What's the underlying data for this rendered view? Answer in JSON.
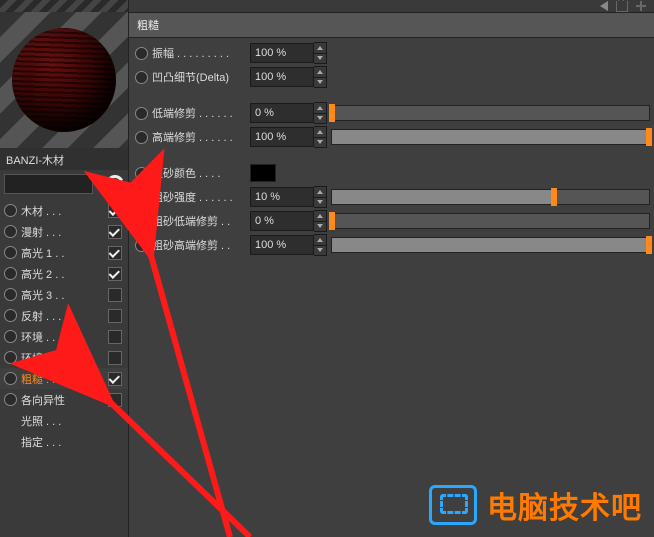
{
  "material_name": "BANZI-木材",
  "group_title": "粗糙",
  "channels": [
    {
      "label": "木材 . . .",
      "checked": true,
      "hasBox": true,
      "hasRadio": true
    },
    {
      "label": "漫射 . . .",
      "checked": true,
      "hasBox": true,
      "hasRadio": true
    },
    {
      "label": "高光 1 . .",
      "checked": true,
      "hasBox": true,
      "hasRadio": true
    },
    {
      "label": "高光 2 . .",
      "checked": true,
      "hasBox": true,
      "hasRadio": true
    },
    {
      "label": "高光 3 . .",
      "checked": false,
      "hasBox": true,
      "hasRadio": true
    },
    {
      "label": "反射 . . .",
      "checked": false,
      "hasBox": true,
      "hasRadio": true
    },
    {
      "label": "环境 . . .",
      "checked": false,
      "hasBox": true,
      "hasRadio": true
    },
    {
      "label": "环境光 . .",
      "checked": false,
      "hasBox": true,
      "hasRadio": true
    },
    {
      "label": "粗糙 . . .",
      "checked": true,
      "hasBox": true,
      "hasRadio": true,
      "selected": true
    },
    {
      "label": "各向异性",
      "checked": false,
      "hasBox": true,
      "hasRadio": true
    },
    {
      "label": "光照 . . .",
      "checked": false,
      "hasBox": false,
      "hasRadio": false
    },
    {
      "label": "指定 . . .",
      "checked": false,
      "hasBox": false,
      "hasRadio": false
    }
  ],
  "params": {
    "amplitude": {
      "label": "振幅 . . . . . . . . .",
      "value": "100 %",
      "slider": false
    },
    "delta": {
      "label": "凹凸细节(Delta)",
      "value": "100 %",
      "slider": false
    },
    "low_clip": {
      "label": "低端修剪 . . . . . .",
      "value": "0 %",
      "slider": true,
      "pct": 0
    },
    "high_clip": {
      "label": "高端修剪 . . . . . .",
      "value": "100 %",
      "slider": true,
      "pct": 100
    },
    "grit_color": {
      "label": "粗砂颜色 . . . .",
      "value": "",
      "swatch": "#000000"
    },
    "grit_intensity": {
      "label": "粗砂强度 . . . . . .",
      "value": "10 %",
      "slider": true,
      "pct": 70
    },
    "grit_low_clip": {
      "label": "粗砂低端修剪 . .",
      "value": "0 %",
      "slider": true,
      "pct": 0
    },
    "grit_high_clip": {
      "label": "粗砂高端修剪 . .",
      "value": "100 %",
      "slider": true,
      "pct": 100
    }
  },
  "watermark": "电脑技术吧"
}
